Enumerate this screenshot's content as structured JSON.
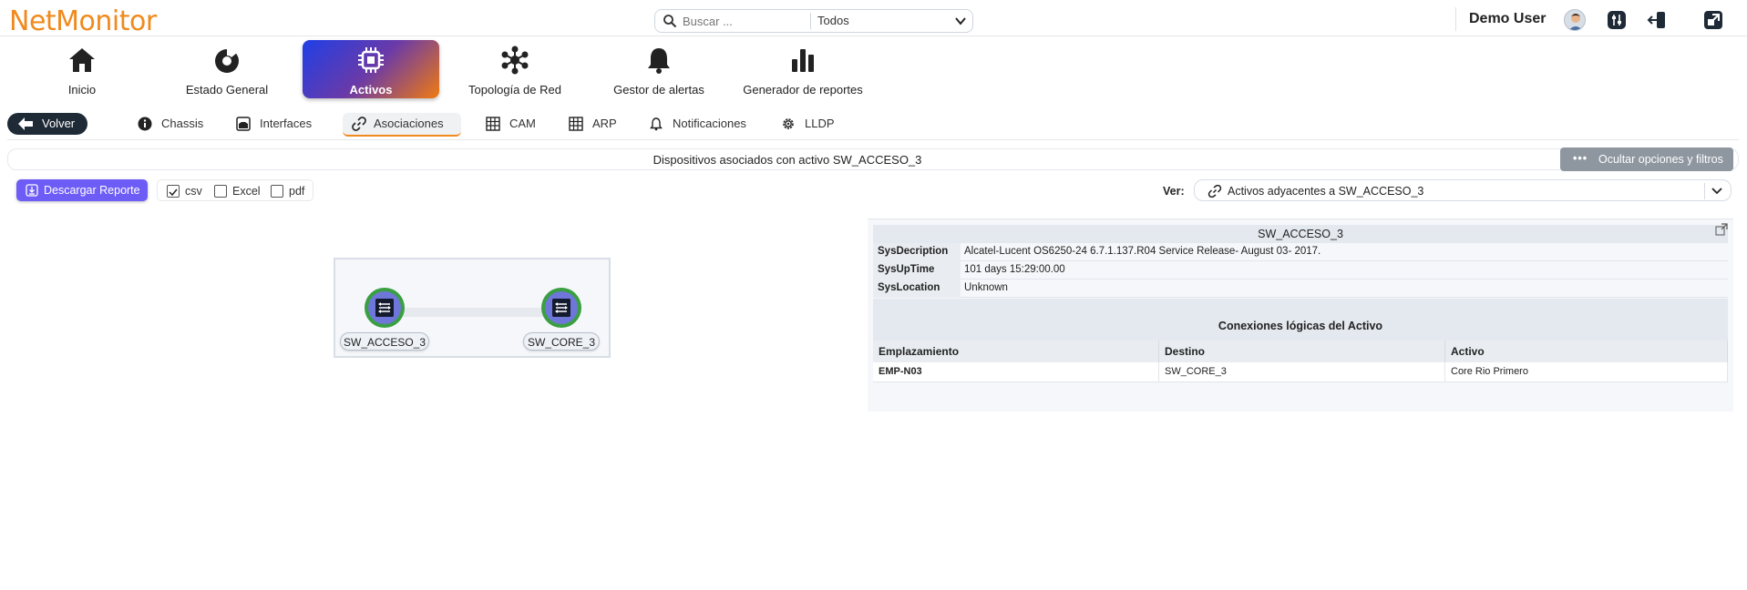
{
  "app": {
    "logo": "NetMonitor"
  },
  "search": {
    "placeholder": "Buscar ...",
    "scope": "Todos"
  },
  "user": {
    "name": "Demo User"
  },
  "nav": {
    "items": [
      {
        "label": "Inicio",
        "icon": "home-icon"
      },
      {
        "label": "Estado General",
        "icon": "pie-chart-icon"
      },
      {
        "label": "Activos",
        "icon": "chip-icon",
        "active": true
      },
      {
        "label": "Topología de Red",
        "icon": "network-icon"
      },
      {
        "label": "Gestor de alertas",
        "icon": "bell-icon"
      },
      {
        "label": "Generador de reportes",
        "icon": "bar-chart-icon"
      }
    ]
  },
  "subnav": {
    "back": "Volver",
    "tabs": [
      {
        "label": "Chassis",
        "icon": "info-icon"
      },
      {
        "label": "Interfaces",
        "icon": "interfaces-icon"
      },
      {
        "label": "Asociaciones",
        "icon": "link-icon",
        "active": true
      },
      {
        "label": "CAM",
        "icon": "table-icon"
      },
      {
        "label": "ARP",
        "icon": "table-icon"
      },
      {
        "label": "Notificaciones",
        "icon": "bell-icon"
      },
      {
        "label": "LLDP",
        "icon": "gear-icon"
      }
    ]
  },
  "infobar": {
    "text": "Dispositivos asociados con activo SW_ACCESO_3",
    "toggle_label": "Ocultar opciones y filtros"
  },
  "report": {
    "download_label": "Descargar Reporte",
    "formats": [
      {
        "label": "csv",
        "checked": true
      },
      {
        "label": "Excel",
        "checked": false
      },
      {
        "label": "pdf",
        "checked": false
      }
    ]
  },
  "view": {
    "label": "Ver:",
    "selected": "Activos adyacentes a SW_ACCESO_3"
  },
  "graph": {
    "nodes": [
      {
        "label": "SW_ACCESO_3"
      },
      {
        "label": "SW_CORE_3"
      }
    ]
  },
  "detail": {
    "title": "SW_ACCESO_3",
    "fields": [
      {
        "key": "SysDecription",
        "value": "Alcatel-Lucent OS6250-24 6.7.1.137.R04 Service Release- August 03- 2017."
      },
      {
        "key": "SysUpTime",
        "value": "101 days 15:29:00.00"
      },
      {
        "key": "SysLocation",
        "value": "Unknown"
      }
    ],
    "connections_title": "Conexiones lógicas del Activo",
    "columns": [
      "Emplazamiento",
      "Destino",
      "Activo"
    ],
    "rows": [
      [
        "EMP-N03",
        "SW_CORE_3",
        "Core Rio Primero"
      ]
    ]
  },
  "colors": {
    "brand": "#f08a1d",
    "accent": "#6e5cf6",
    "dark": "#1e2a36",
    "node_ring": "#3a9f42"
  }
}
